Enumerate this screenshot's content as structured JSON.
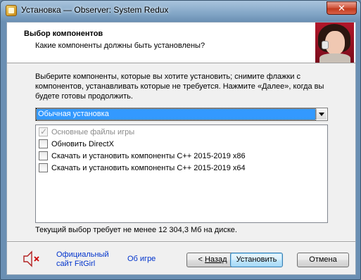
{
  "window": {
    "title": "Установка — Observer: System Redux",
    "close_label": "✕"
  },
  "header": {
    "title": "Выбор компонентов",
    "subtitle": "Какие компоненты должны быть установлены?"
  },
  "body": {
    "description": "Выберите компоненты, которые вы хотите установить; снимите флажки с компонентов, устанавливать которые не требуется. Нажмите «Далее», когда вы будете готовы продолжить.",
    "install_type": {
      "selected": "Обычная установка"
    },
    "components": [
      {
        "label": "Основные файлы игры",
        "checked": true,
        "disabled": true
      },
      {
        "label": "Обновить DirectX",
        "checked": false,
        "disabled": false
      },
      {
        "label": "Скачать и установить компоненты C++ 2015-2019 x86",
        "checked": false,
        "disabled": false
      },
      {
        "label": "Скачать и установить компоненты C++ 2015-2019 x64",
        "checked": false,
        "disabled": false
      }
    ],
    "space_required": "Текущий выбор требует не менее 12 304,3 Мб на диске."
  },
  "footer": {
    "site_link_line1": "Официальный",
    "site_link_line2": "сайт FitGirl",
    "about_link": "Об игре",
    "back_prefix": "< ",
    "back_label": "Назад",
    "install_label": "Установить",
    "cancel_label": "Отмена"
  },
  "colors": {
    "selection": "#3399ff",
    "link": "#0033cc",
    "mute_x": "#cc0000",
    "speaker": "#b22222"
  }
}
